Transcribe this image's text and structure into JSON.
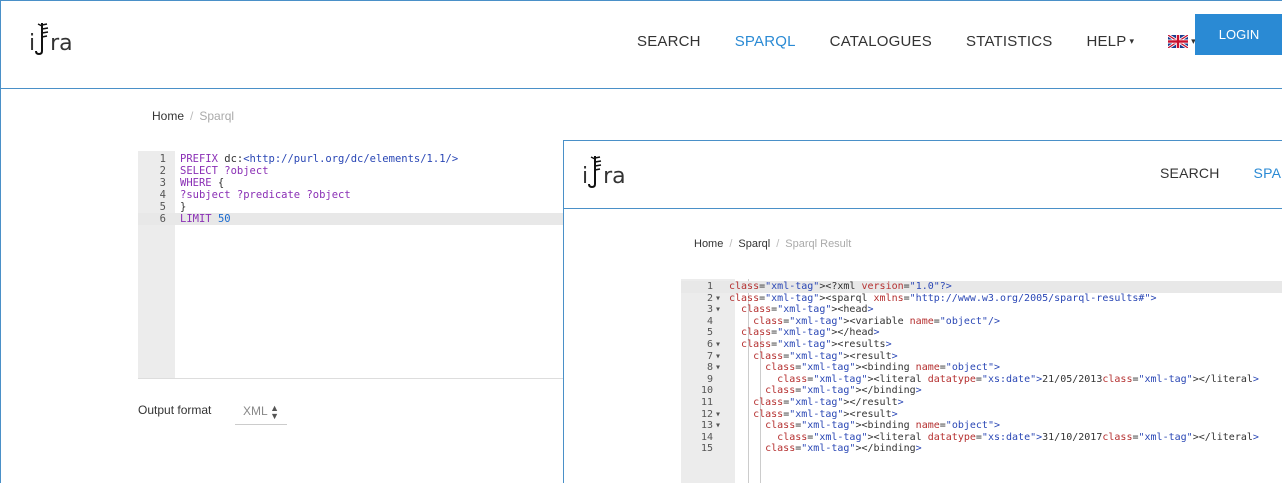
{
  "back": {
    "logo": {
      "i": "i",
      "ra": "ra"
    },
    "nav": {
      "search": "SEARCH",
      "sparql": "SPARQL",
      "catalogues": "CATALOGUES",
      "statistics": "STATISTICS",
      "help": "HELP",
      "login": "LOGIN"
    },
    "breadcrumb": {
      "home": "Home",
      "current": "Sparql"
    },
    "editor": {
      "lines": [
        {
          "n": "1",
          "text": "PREFIX dc:<http://purl.org/dc/elements/1.1/>"
        },
        {
          "n": "2",
          "text": "SELECT ?object"
        },
        {
          "n": "3",
          "text": "WHERE {"
        },
        {
          "n": "4",
          "text": "?subject ?predicate ?object"
        },
        {
          "n": "5",
          "text": "}"
        },
        {
          "n": "6",
          "text": "LIMIT 50"
        }
      ]
    },
    "output_format": {
      "label": "Output format",
      "value": "XML"
    }
  },
  "front": {
    "nav": {
      "search": "SEARCH",
      "sparql": "SPAR"
    },
    "breadcrumb": {
      "home": "Home",
      "sparql": "Sparql",
      "current": "Sparql Result"
    },
    "editor": {
      "lines": [
        {
          "n": "1",
          "fold": "",
          "text": "<?xml version=\"1.0\"?>"
        },
        {
          "n": "2",
          "fold": "▾",
          "text": "<sparql xmlns=\"http://www.w3.org/2005/sparql-results#\">"
        },
        {
          "n": "3",
          "fold": "▾",
          "text": "  <head>"
        },
        {
          "n": "4",
          "fold": "",
          "text": "    <variable name=\"object\"/>"
        },
        {
          "n": "5",
          "fold": "",
          "text": "  </head>"
        },
        {
          "n": "6",
          "fold": "▾",
          "text": "  <results>"
        },
        {
          "n": "7",
          "fold": "▾",
          "text": "    <result>"
        },
        {
          "n": "8",
          "fold": "▾",
          "text": "      <binding name=\"object\">"
        },
        {
          "n": "9",
          "fold": "",
          "text": "        <literal datatype=\"xs:date\">21/05/2013</literal>"
        },
        {
          "n": "10",
          "fold": "",
          "text": "      </binding>"
        },
        {
          "n": "11",
          "fold": "",
          "text": "    </result>"
        },
        {
          "n": "12",
          "fold": "▾",
          "text": "    <result>"
        },
        {
          "n": "13",
          "fold": "▾",
          "text": "      <binding name=\"object\">"
        },
        {
          "n": "14",
          "fold": "",
          "text": "        <literal datatype=\"xs:date\">31/10/2017</literal>"
        },
        {
          "n": "15",
          "fold": "",
          "text": "      </binding>"
        }
      ]
    }
  },
  "colors": {
    "accent": "#2a8ad4",
    "border": "#4a90c8"
  }
}
